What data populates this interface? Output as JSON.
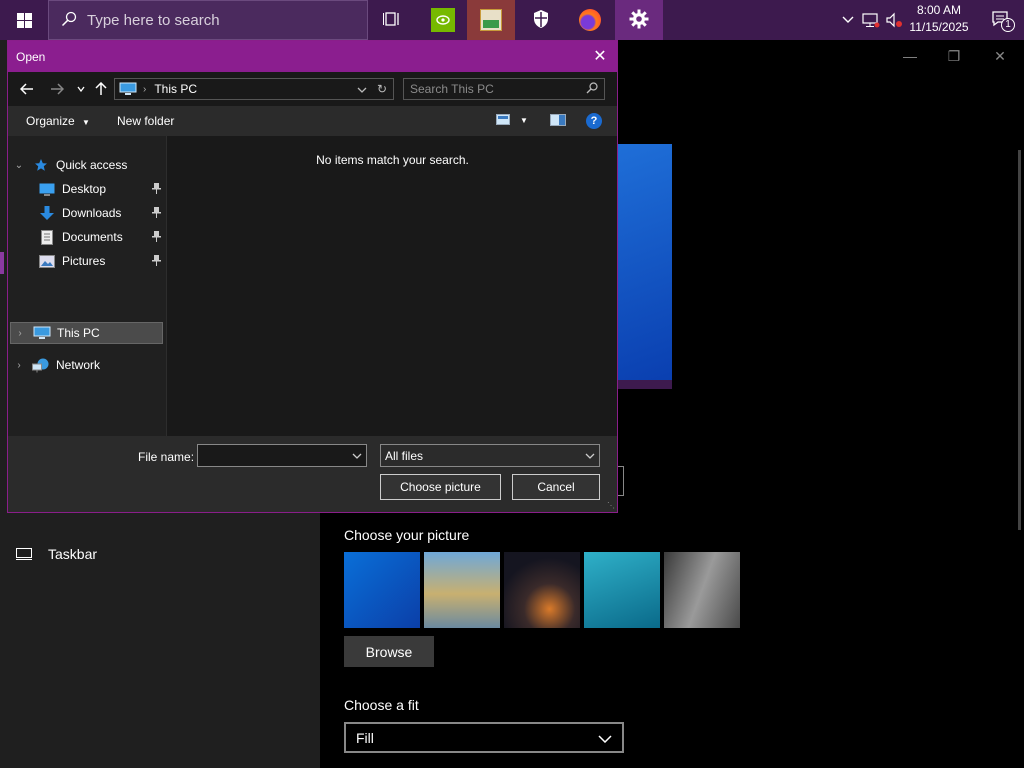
{
  "taskbar": {
    "search_placeholder": "Type here to search",
    "clock_time": "8:00 AM",
    "clock_date": "11/15/2025",
    "notification_count": "1",
    "accent": "#3d1a4e"
  },
  "settings": {
    "nav_taskbar": "Taskbar",
    "choose_picture_label": "Choose your picture",
    "browse_label": "Browse",
    "fit_label": "Choose a fit",
    "fit_value": "Fill"
  },
  "dialog": {
    "title": "Open",
    "address_path": "This PC",
    "search_placeholder": "Search This PC",
    "organize_label": "Organize",
    "new_folder_label": "New folder",
    "empty_message": "No items match your search.",
    "tree": {
      "quick_access": "Quick access",
      "desktop": "Desktop",
      "downloads": "Downloads",
      "documents": "Documents",
      "pictures": "Pictures",
      "this_pc": "This PC",
      "network": "Network"
    },
    "file_name_label": "File name:",
    "file_name_value": "",
    "file_type_value": "All files",
    "choose_button": "Choose picture",
    "cancel_button": "Cancel",
    "title_color": "#8b1e8f"
  }
}
